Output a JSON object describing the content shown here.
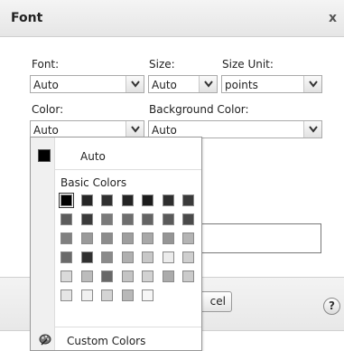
{
  "dialog": {
    "title": "Font",
    "close_glyph": "x"
  },
  "fields": {
    "font_label": "Font:",
    "font_value": "Auto",
    "size_label": "Size:",
    "size_value": "Auto",
    "size_unit_label": "Size Unit:",
    "size_unit_value": "points",
    "color_label": "Color:",
    "color_value": "Auto",
    "bg_color_label": "Background Color:",
    "bg_color_value": "Auto"
  },
  "footer": {
    "cancel_partial_label": "cel",
    "help_glyph": "?"
  },
  "color_panel": {
    "auto_label": "Auto",
    "auto_color": "#000000",
    "basic_colors_label": "Basic Colors",
    "custom_colors_label": "Custom Colors",
    "icons": [
      "chevron-down-icon",
      "palette-icon",
      "help-icon",
      "close-icon"
    ],
    "rows": [
      [
        "#000000",
        "#262626",
        "#303030",
        "#242424",
        "#1c1c1c",
        "#2e2e2e",
        "#3a3a3a"
      ],
      [
        "#5c5c5c",
        "#3a3a3a",
        "#7a7a7a",
        "#6e6e6e",
        "#646464",
        "#5a5a5a",
        "#4a4a4a"
      ],
      [
        "#808080",
        "#9a9a9a",
        "#8c8c8c",
        "#9e9e9e",
        "#a8a8a8",
        "#959595",
        "#b4b4b4"
      ],
      [
        "#6a6a6a",
        "#303030",
        "#8a8a8a",
        "#b0b0b0",
        "#c8c8c8",
        "#ececec",
        "#cfcfcf"
      ],
      [
        "#dadada",
        "#bcbcbc",
        "#686868",
        "#c4c4c4",
        "#d2d2d2",
        "#ababab",
        "#cbcbcb"
      ],
      [
        "#e6e6e6",
        "#f0f0f0",
        "#d4d4d4",
        "#b8b8b8",
        "#f6f6f6"
      ]
    ]
  }
}
